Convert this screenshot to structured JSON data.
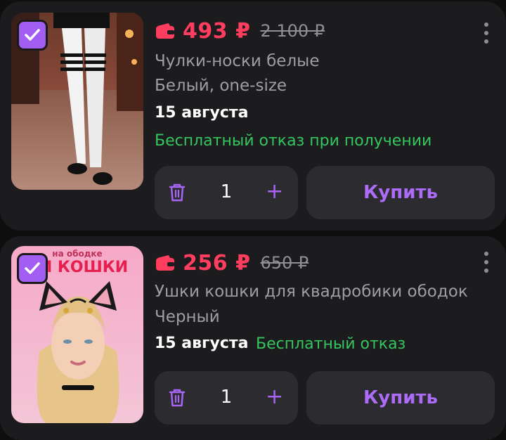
{
  "colors": {
    "accent_purple": "#a25df2",
    "price_red": "#ff3d5e",
    "refund_green": "#34c55e",
    "card_bg": "#1c1c1f",
    "button_bg": "#2c2c30"
  },
  "items": [
    {
      "price": "493 ₽",
      "old_price": "2 100 ₽",
      "title": "Чулки-носки белые",
      "variant": "Белый, one-size",
      "delivery": "15 августа",
      "refund": "Бесплатный отказ при получении",
      "quantity": "1",
      "plus": "+",
      "buy_label": "Купить",
      "image_caption": ""
    },
    {
      "price": "256 ₽",
      "old_price": "650 ₽",
      "title": "Ушки кошки для квадробики ободок",
      "variant": "Черный",
      "delivery": "15 августа",
      "refund": "Бесплатный отказ",
      "quantity": "1",
      "plus": "+",
      "buy_label": "Купить",
      "image_caption_top": "на ободке",
      "image_caption_main": "КИ КОШКИ"
    }
  ]
}
